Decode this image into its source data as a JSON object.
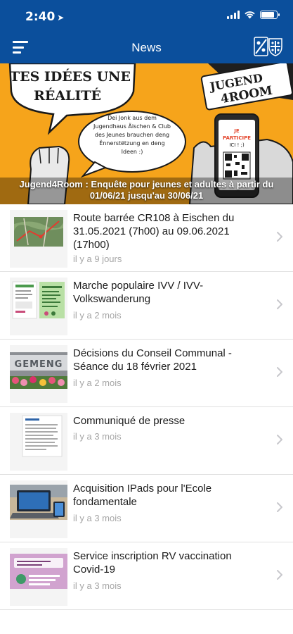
{
  "status": {
    "time": "2:40",
    "battery_level": 0.85
  },
  "nav": {
    "title": "News"
  },
  "hero": {
    "speech_big": [
      "TES IDÉES UNE",
      "RÉALITÉ"
    ],
    "speech_small": [
      "Dei Jonk aus dem",
      "Jugendhaus Äischen & Club",
      "des Jeunes brauchen deng",
      "Ënnerstëtzung en deng",
      "Ideen :)"
    ],
    "poster_top": "JUGEND",
    "poster_brand": "4ROOM",
    "phone_text": [
      "JE",
      "PARTICIPE",
      "ICI ! ;)"
    ],
    "caption_line1": "Jugend4Room : Enquête pour jeunes et adultes à partir du",
    "caption_line2": "01/06/21 jusqu'au 30/06/21"
  },
  "news": [
    {
      "title": "Route barrée CR108 à Eischen du 31.05.2021 (7h00) au 09.06.2021 (17h00)",
      "date": "il y a 9 jours",
      "thumb": "map"
    },
    {
      "title": "Marche populaire IVV / IVV-Volkswanderung",
      "date": "il y a 2 mois",
      "thumb": "flyer"
    },
    {
      "title": "Décisions du Conseil Communal - Séance du 18 février 2021",
      "date": "il y a 2 mois",
      "thumb": "gemeng",
      "thumb_text": "GEMENG"
    },
    {
      "title": "Communiqué de presse",
      "date": "il y a 3 mois",
      "thumb": "document"
    },
    {
      "title": "Acquisition IPads pour l'Ecole fondamentale",
      "date": "il y a 3 mois",
      "thumb": "laptop"
    },
    {
      "title": "Service inscription RV vaccination Covid-19",
      "date": "il y a 3 mois",
      "thumb": "vaccine"
    }
  ]
}
